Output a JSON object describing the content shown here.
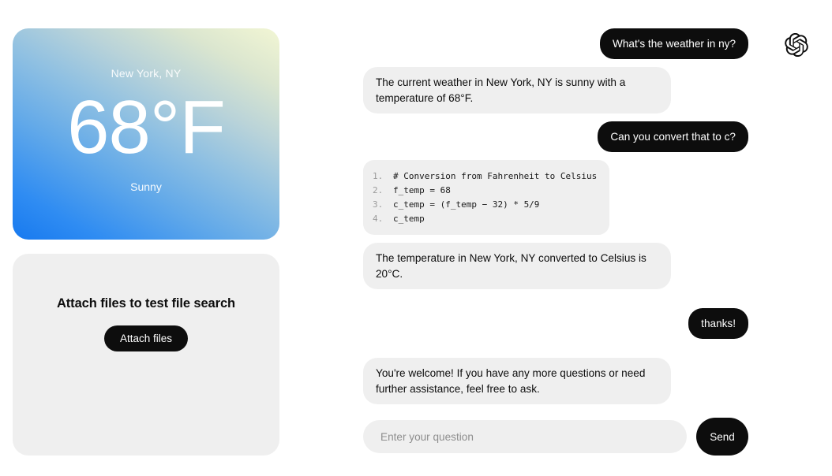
{
  "weather_card": {
    "city": "New York, NY",
    "temperature": "68°F",
    "condition": "Sunny",
    "gradient_from": "#1779ef",
    "gradient_to": "#f2f6d4"
  },
  "file_panel": {
    "title": "Attach files to test file search",
    "attach_button": "Attach files",
    "background": "#efefef"
  },
  "brand": {
    "logo_name": "openai-logo"
  },
  "chat": {
    "messages": [
      {
        "role": "user",
        "text": "What's the weather in ny?"
      },
      {
        "role": "assistant",
        "text": "The current weather in New York, NY is sunny with a temperature of 68°F."
      },
      {
        "role": "user",
        "text": "Can you convert that to c?"
      },
      {
        "role": "assistant-code",
        "code_lines": [
          {
            "num": "1.",
            "text": "# Conversion from Fahrenheit to Celsius"
          },
          {
            "num": "2.",
            "text": "f_temp = 68"
          },
          {
            "num": "3.",
            "text": "c_temp = (f_temp − 32) * 5/9"
          },
          {
            "num": "4.",
            "text": "c_temp"
          }
        ]
      },
      {
        "role": "assistant",
        "text": "The temperature in New York, NY converted to Celsius is 20°C."
      },
      {
        "role": "user",
        "text": "thanks!"
      },
      {
        "role": "assistant",
        "text": "You're welcome! If you have any more questions or need further assistance, feel free to ask."
      }
    ]
  },
  "composer": {
    "placeholder": "Enter your question",
    "value": "",
    "send_label": "Send"
  },
  "colors": {
    "bubble_user_bg": "#0d0d0d",
    "bubble_assistant_bg": "#efefef",
    "page_bg": "#ffffff"
  }
}
